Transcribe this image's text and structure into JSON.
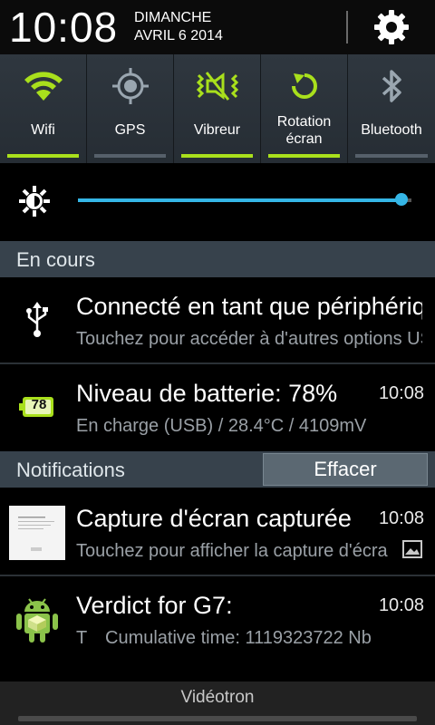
{
  "header": {
    "time": "10:08",
    "day": "DIMANCHE",
    "date": "AVRIL 6 2014"
  },
  "toggles": [
    {
      "label": "Wifi",
      "on": true,
      "icon": "wifi-icon"
    },
    {
      "label": "GPS",
      "on": false,
      "icon": "gps-icon"
    },
    {
      "label": "Vibreur",
      "on": true,
      "icon": "vibrate-icon"
    },
    {
      "label_line1": "Rotation",
      "label_line2": "écran",
      "on": true,
      "icon": "rotation-icon"
    },
    {
      "label": "Bluetooth",
      "on": false,
      "icon": "bluetooth-icon"
    }
  ],
  "brightness": {
    "level": 0.97,
    "icon": "brightness-icon"
  },
  "ongoing": {
    "title": "En cours",
    "usb": {
      "title": "Connecté en tant que périphérique multimédia",
      "subtitle": "Touchez pour accéder à d'autres options USB"
    },
    "battery": {
      "badge": "78",
      "title": "Niveau de batterie: 78%",
      "time": "10:08",
      "subtitle": "En charge (USB) / 28.4°C / 4109mV"
    }
  },
  "notifications": {
    "title": "Notifications",
    "clear_label": "Effacer",
    "screenshot": {
      "title": "Capture d'écran capturée",
      "time": "10:08",
      "subtitle": "Touchez pour afficher la capture d'écran"
    },
    "verdict": {
      "title": "Verdict for G7:",
      "time": "10:08",
      "subtitle_prefix": "T",
      "subtitle": "Cumulative time: 1119323722 Nb"
    }
  },
  "carrier": "Vidéotron",
  "colors": {
    "accent_green": "#a9e01c",
    "slider_blue": "#35b6e6",
    "section_bg": "#37424c"
  }
}
